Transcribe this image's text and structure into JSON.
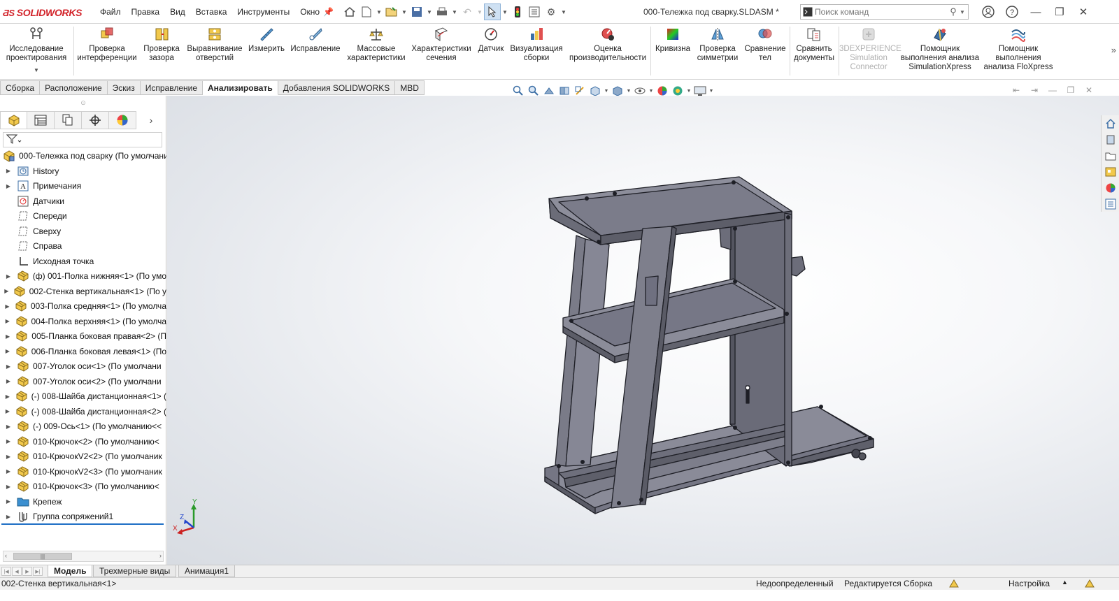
{
  "app": {
    "brand": "SOLIDWORKS",
    "document_title": "000-Тележка под сварку.SLDASM *"
  },
  "menu": [
    "Файл",
    "Правка",
    "Вид",
    "Вставка",
    "Инструменты",
    "Окно"
  ],
  "search": {
    "placeholder": "Поиск команд"
  },
  "ribbon": {
    "buttons": [
      {
        "label1": "Исследование",
        "label2": "проектирования",
        "icon": "design-study-icon"
      },
      {
        "label1": "Проверка",
        "label2": "интерференции",
        "icon": "interference-icon"
      },
      {
        "label1": "Проверка",
        "label2": "зазора",
        "icon": "clearance-icon"
      },
      {
        "label1": "Выравнивание",
        "label2": "отверстий",
        "icon": "hole-alignment-icon"
      },
      {
        "label1": "Измерить",
        "label2": "",
        "icon": "measure-icon"
      },
      {
        "label1": "Исправление",
        "label2": "",
        "icon": "repair-icon"
      },
      {
        "label1": "Массовые",
        "label2": "характеристики",
        "icon": "mass-properties-icon"
      },
      {
        "label1": "Характеристики",
        "label2": "сечения",
        "icon": "section-properties-icon"
      },
      {
        "label1": "Датчик",
        "label2": "",
        "icon": "sensor-icon"
      },
      {
        "label1": "Визуализация",
        "label2": "сборки",
        "icon": "assembly-visualization-icon"
      },
      {
        "label1": "Оценка",
        "label2": "производительности",
        "icon": "performance-icon"
      },
      {
        "label1": "Кривизна",
        "label2": "",
        "icon": "curvature-icon"
      },
      {
        "label1": "Проверка",
        "label2": "симметрии",
        "icon": "symmetry-icon"
      },
      {
        "label1": "Сравнение",
        "label2": "тел",
        "icon": "compare-bodies-icon"
      },
      {
        "label1": "Сравнить",
        "label2": "документы",
        "icon": "compare-documents-icon"
      },
      {
        "label1": "3DEXPERIENCE",
        "label2": "Simulation",
        "label3": "Connector",
        "icon": "3dx-connector-icon"
      },
      {
        "label1": "Помощник",
        "label2": "выполнения анализа",
        "label3": "SimulationXpress",
        "icon": "simxpress-icon"
      },
      {
        "label1": "Помощник",
        "label2": "выполнения",
        "label3": "анализа FloXpress",
        "icon": "floxpress-icon"
      }
    ]
  },
  "tabs": [
    "Сборка",
    "Расположение",
    "Эскиз",
    "Исправление",
    "Анализировать",
    "Добавления SOLIDWORKS",
    "MBD"
  ],
  "active_tab": "Анализировать",
  "tree": {
    "root": "000-Тележка под сварку  (По умолчани",
    "items": [
      {
        "label": "History",
        "expand": true,
        "icon": "history-icon"
      },
      {
        "label": "Примечания",
        "expand": true,
        "icon": "annotations-icon"
      },
      {
        "label": "Датчики",
        "expand": false,
        "icon": "sensors-icon"
      },
      {
        "label": "Спереди",
        "expand": false,
        "icon": "plane-icon"
      },
      {
        "label": "Сверху",
        "expand": false,
        "icon": "plane-icon"
      },
      {
        "label": "Справа",
        "expand": false,
        "icon": "plane-icon"
      },
      {
        "label": "Исходная точка",
        "expand": false,
        "icon": "origin-icon"
      },
      {
        "label": "(ф) 001-Полка нижняя<1> (По умо",
        "expand": true,
        "icon": "part-icon"
      },
      {
        "label": "002-Стенка вертикальная<1> (По у",
        "expand": true,
        "icon": "part-icon"
      },
      {
        "label": "003-Полка средняя<1> (По умолча",
        "expand": true,
        "icon": "part-icon"
      },
      {
        "label": "004-Полка верхняя<1> (По умолча",
        "expand": true,
        "icon": "part-icon"
      },
      {
        "label": "005-Планка боковая правая<2> (П",
        "expand": true,
        "icon": "part-icon"
      },
      {
        "label": "006-Планка боковая левая<1> (По",
        "expand": true,
        "icon": "part-icon"
      },
      {
        "label": "007-Уголок оси<1> (По умолчани",
        "expand": true,
        "icon": "part-icon"
      },
      {
        "label": "007-Уголок оси<2> (По умолчани",
        "expand": true,
        "icon": "part-icon"
      },
      {
        "label": "(-) 008-Шайба дистанционная<1> (",
        "expand": true,
        "icon": "part-icon"
      },
      {
        "label": "(-) 008-Шайба дистанционная<2> (",
        "expand": true,
        "icon": "part-icon"
      },
      {
        "label": "(-) 009-Ось<1> (По умолчанию<<",
        "expand": true,
        "icon": "part-icon"
      },
      {
        "label": "010-Крючок<2> (По умолчанию<",
        "expand": true,
        "icon": "part-icon"
      },
      {
        "label": "010-КрючокV2<2> (По умолчаник",
        "expand": true,
        "icon": "part-icon"
      },
      {
        "label": "010-КрючокV2<3> (По умолчаник",
        "expand": true,
        "icon": "part-icon"
      },
      {
        "label": "010-Крючок<3> (По умолчанию<",
        "expand": true,
        "icon": "part-icon"
      },
      {
        "label": "Крепеж",
        "expand": true,
        "icon": "folder-icon"
      },
      {
        "label": "Группа сопряжений1",
        "expand": true,
        "icon": "mates-icon"
      }
    ]
  },
  "bottom_tabs": [
    "Модель",
    "Трехмерные виды",
    "Анимация1"
  ],
  "status": {
    "selected": "002-Стенка вертикальная<1>",
    "definition": "Недоопределенный",
    "editing": "Редактируется Сборка",
    "customize": "Настройка"
  },
  "triad": {
    "x": "X",
    "y": "Y",
    "z": "Z"
  },
  "colors": {
    "brand": "#d2232a",
    "model": "#747584",
    "active_tab_line": "#1f6fc5"
  }
}
